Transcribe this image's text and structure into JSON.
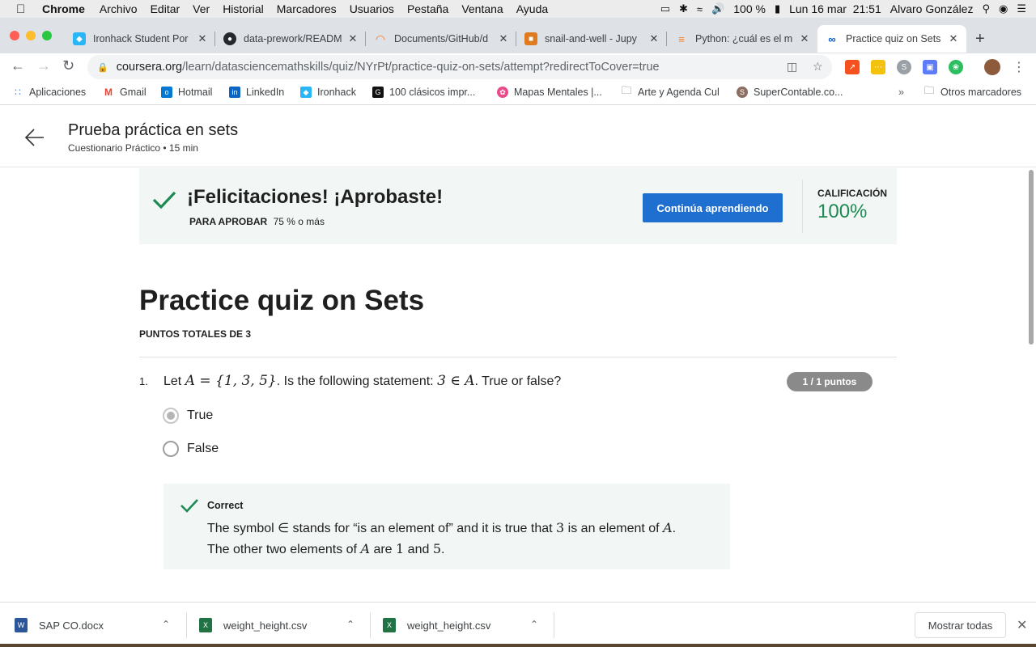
{
  "menubar": {
    "app": "Chrome",
    "items": [
      "Archivo",
      "Editar",
      "Ver",
      "Historial",
      "Marcadores",
      "Usuarios",
      "Pestaña",
      "Ventana",
      "Ayuda"
    ],
    "battery": "100 %",
    "datetime": "Lun 16 mar  21:51",
    "user": "Alvaro González"
  },
  "tabs": [
    {
      "label": "Ironhack Student Por",
      "color": "#29b6f6"
    },
    {
      "label": "data-prework/READM",
      "color": "#24292e"
    },
    {
      "label": "Documents/GitHub/d",
      "color": "#f37726"
    },
    {
      "label": "snail-and-well - Jupy",
      "color": "#e07a1f"
    },
    {
      "label": "Python: ¿cuál es el m",
      "color": "#f48024"
    },
    {
      "label": "Practice quiz on Sets",
      "color": "#0056d2"
    }
  ],
  "address": {
    "domain": "coursera.org",
    "path": "/learn/datasciencemathskills/quiz/NYrPt/practice-quiz-on-sets/attempt?redirectToCover=true"
  },
  "bookmarks": [
    {
      "label": "Aplicaciones",
      "color": "#4285f4"
    },
    {
      "label": "Gmail",
      "color": "#ea4335"
    },
    {
      "label": "Hotmail",
      "color": "#0078d4"
    },
    {
      "label": "LinkedIn",
      "color": "#0a66c2"
    },
    {
      "label": "Ironhack",
      "color": "#29b6f6"
    },
    {
      "label": "100 clásicos impr...",
      "color": "#111111"
    },
    {
      "label": "Mapas Mentales |...",
      "color": "#e84a8a"
    },
    {
      "label": "Arte y Agenda Cul",
      "color": "#777777"
    },
    {
      "label": "SuperContable.co...",
      "color": "#8d6e63"
    },
    {
      "label": "Otros marcadores",
      "color": "#777777"
    }
  ],
  "course": {
    "title": "Prueba práctica en sets",
    "subtitle": "Cuestionario Práctico • 15 min"
  },
  "banner": {
    "title": "¡Felicitaciones! ¡Aprobaste!",
    "pass_label": "PARA APROBAR",
    "pass_value": "75 % o más",
    "button": "Continúa aprendiendo",
    "grade_label": "CALIFICACIÓN",
    "grade_value": "100%"
  },
  "quiz": {
    "title": "Practice quiz on Sets",
    "total_points": "PUNTOS TOTALES DE 3"
  },
  "question": {
    "number": "1.",
    "text_prefix": "Let",
    "set_expr": "A = {1, 3, 5}",
    "text_mid": ". Is the following statement:",
    "stmt_expr": "3 ∈ A",
    "text_suffix": ". True or false?",
    "points": "1 / 1 puntos",
    "options": [
      "True",
      "False"
    ],
    "selected": "True"
  },
  "feedback": {
    "label": "Correct",
    "line1_a": "The symbol ∈ stands for “is an element of” and it is true that",
    "line1_num": "3",
    "line1_b": "is an element of",
    "line1_var": "A",
    "line2_a": "The other two elements of",
    "line2_var": "A",
    "line2_b": "are",
    "line2_n1": "1",
    "line2_and": "and",
    "line2_n2": "5"
  },
  "downloads": [
    {
      "name": "SAP CO.docx",
      "color": "#2b579a",
      "icon": "W"
    },
    {
      "name": "weight_height.csv",
      "color": "#217346",
      "icon": "X"
    },
    {
      "name": "weight_height.csv",
      "color": "#217346",
      "icon": "X"
    }
  ],
  "show_all": "Mostrar todas"
}
